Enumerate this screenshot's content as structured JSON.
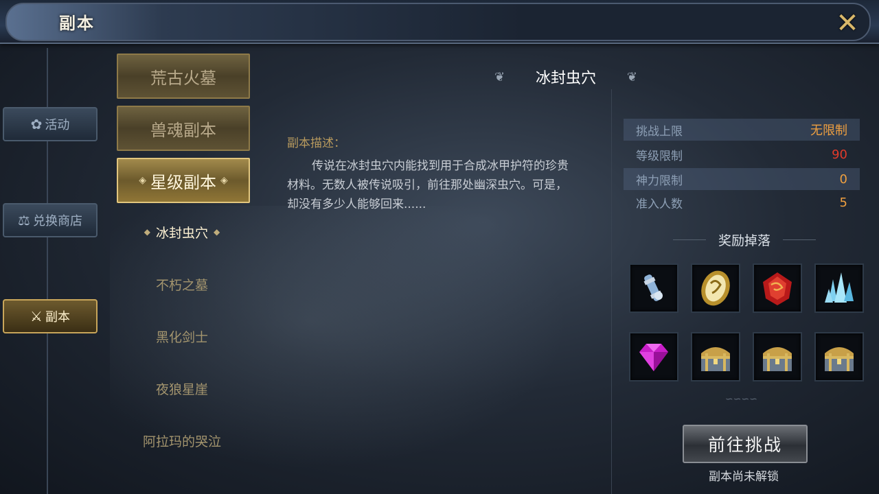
{
  "header": {
    "title": "副本",
    "close_icon": "close-x-icon"
  },
  "nav": {
    "items": [
      {
        "label": "活动",
        "icon": "✿",
        "icon_name": "flower-icon"
      },
      {
        "label": "兑换商店",
        "icon": "⚖",
        "icon_name": "scales-icon"
      },
      {
        "label": "副本",
        "icon": "⚔",
        "icon_name": "crossed-swords-icon"
      }
    ],
    "active_index": 2
  },
  "categories": [
    {
      "label": "荒古火墓"
    },
    {
      "label": "兽魂副本"
    },
    {
      "label": "星级副本"
    }
  ],
  "dungeons": [
    {
      "label": "冰封虫穴"
    },
    {
      "label": "不朽之墓"
    },
    {
      "label": "黑化剑士"
    },
    {
      "label": "夜狼星崖"
    },
    {
      "label": "阿拉玛的哭泣"
    }
  ],
  "detail": {
    "title": "冰封虫穴",
    "desc_label": "副本描述：",
    "description": "传说在冰封虫穴内能找到用于合成冰甲护符的珍贵材料。无数人被传说吸引，前往那处幽深虫穴。可是，却没有多少人能够回来......",
    "stats": [
      {
        "label": "挑战上限",
        "value": "无限制",
        "color": "#f0a040"
      },
      {
        "label": "等级限制",
        "value": "90",
        "color": "#e23a2a"
      },
      {
        "label": "神力限制",
        "value": "0",
        "color": "#f0a040"
      },
      {
        "label": "准入人数",
        "value": "5",
        "color": "#f0a040"
      }
    ],
    "reward_label": "奖励掉落",
    "rewards": [
      {
        "icon_name": "scroll-vial-icon"
      },
      {
        "icon_name": "golden-shield-icon"
      },
      {
        "icon_name": "red-gem-icon"
      },
      {
        "icon_name": "ice-crystal-icon"
      },
      {
        "icon_name": "purple-diamond-icon"
      },
      {
        "icon_name": "treasure-chest-icon"
      },
      {
        "icon_name": "treasure-chest-icon"
      },
      {
        "icon_name": "treasure-chest-icon"
      }
    ],
    "challenge_button": "前往挑战",
    "lock_note": "副本尚未解锁"
  }
}
